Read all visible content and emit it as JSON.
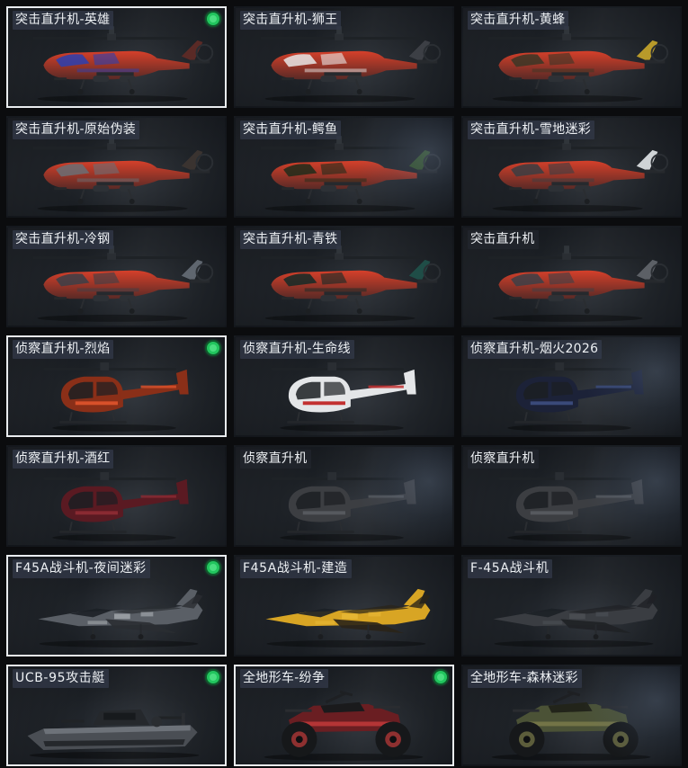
{
  "items": [
    {
      "label": "突击直升机-英雄",
      "type": "attack-heli",
      "status": true,
      "selected": true,
      "colors": {
        "body": "#5a2a26",
        "accent": "#d6402a",
        "accent2": "#2b3fb0"
      }
    },
    {
      "label": "突击直升机-狮王",
      "type": "attack-heli",
      "status": false,
      "selected": false,
      "colors": {
        "body": "#3c3f45",
        "accent": "#c93a3a",
        "accent2": "#e6e6e6"
      }
    },
    {
      "label": "突击直升机-黄蜂",
      "type": "attack-heli",
      "status": false,
      "selected": false,
      "colors": {
        "body": "#b89a2a",
        "accent": "#d9b83a",
        "accent2": "#3a3626"
      }
    },
    {
      "label": "突击直升机-原始伪装",
      "type": "attack-heli",
      "status": false,
      "selected": false,
      "colors": {
        "body": "#3a3330",
        "accent": "#d8703a",
        "accent2": "#6a6e74"
      }
    },
    {
      "label": "突击直升机-鳄鱼",
      "type": "attack-heli",
      "status": false,
      "selected": false,
      "colors": {
        "body": "#34502c",
        "accent": "#4b6f35",
        "accent2": "#1f2b1a"
      }
    },
    {
      "label": "突击直升机-雪地迷彩",
      "type": "attack-heli",
      "status": false,
      "selected": false,
      "colors": {
        "body": "#cfd3d6",
        "accent": "#9aa0a6",
        "accent2": "#3a3d42"
      }
    },
    {
      "label": "突击直升机-冷钢",
      "type": "attack-heli",
      "status": false,
      "selected": false,
      "colors": {
        "body": "#5f666f",
        "accent": "#7a838d",
        "accent2": "#3b4048"
      }
    },
    {
      "label": "突击直升机-青铁",
      "type": "attack-heli",
      "status": false,
      "selected": false,
      "colors": {
        "body": "#1f4d47",
        "accent": "#2a6a60",
        "accent2": "#132a27"
      }
    },
    {
      "label": "突击直升机",
      "type": "attack-heli",
      "status": false,
      "selected": false,
      "colors": {
        "body": "#5c6066",
        "accent": "#74797f",
        "accent2": "#3c4046"
      }
    },
    {
      "label": "侦察直升机-烈焰",
      "type": "scout-heli",
      "status": true,
      "selected": true,
      "colors": {
        "body": "#8a2f18",
        "accent": "#d8502a",
        "accent2": "#2a2a2a"
      }
    },
    {
      "label": "侦察直升机-生命线",
      "type": "scout-heli",
      "status": false,
      "selected": false,
      "colors": {
        "body": "#e4e6e8",
        "accent": "#c23030",
        "accent2": "#3a3a3a"
      }
    },
    {
      "label": "侦察直升机-烟火2026",
      "type": "scout-heli",
      "status": false,
      "selected": false,
      "colors": {
        "body": "#1c2238",
        "accent": "#3a4a7a",
        "accent2": "#0f1220"
      }
    },
    {
      "label": "侦察直升机-酒红",
      "type": "scout-heli",
      "status": false,
      "selected": false,
      "colors": {
        "body": "#5a1a22",
        "accent": "#8a2a32",
        "accent2": "#2a1418"
      }
    },
    {
      "label": "侦察直升机",
      "type": "scout-heli",
      "status": false,
      "selected": false,
      "colors": {
        "body": "#3c3e42",
        "accent": "#56595e",
        "accent2": "#222428"
      }
    },
    {
      "label": "侦察直升机",
      "type": "scout-heli",
      "status": false,
      "selected": false,
      "colors": {
        "body": "#3c3e42",
        "accent": "#56595e",
        "accent2": "#222428"
      }
    },
    {
      "label": "F45A战斗机-夜间迷彩",
      "type": "fighter-jet",
      "status": true,
      "selected": true,
      "colors": {
        "body": "#5a5f66",
        "accent": "#c8ccd0",
        "accent2": "#2a2d32"
      }
    },
    {
      "label": "F45A战斗机-建造",
      "type": "fighter-jet",
      "status": false,
      "selected": false,
      "colors": {
        "body": "#d8a524",
        "accent": "#f0c240",
        "accent2": "#2a2418"
      }
    },
    {
      "label": "F-45A战斗机",
      "type": "fighter-jet",
      "status": false,
      "selected": false,
      "colors": {
        "body": "#3a3d42",
        "accent": "#55595f",
        "accent2": "#1f2125"
      }
    },
    {
      "label": "UCB-95攻击艇",
      "type": "boat",
      "status": true,
      "selected": true,
      "colors": {
        "body": "#4a4e54",
        "accent": "#6d7279",
        "accent2": "#25282c"
      }
    },
    {
      "label": "全地形车-纷争",
      "type": "atv",
      "status": true,
      "selected": true,
      "colors": {
        "body": "#6a1e22",
        "accent": "#c23a3a",
        "accent2": "#1a1a1c"
      }
    },
    {
      "label": "全地形车-森林迷彩",
      "type": "atv",
      "status": false,
      "selected": false,
      "colors": {
        "body": "#4b5236",
        "accent": "#7a7a4a",
        "accent2": "#22241a"
      }
    }
  ]
}
